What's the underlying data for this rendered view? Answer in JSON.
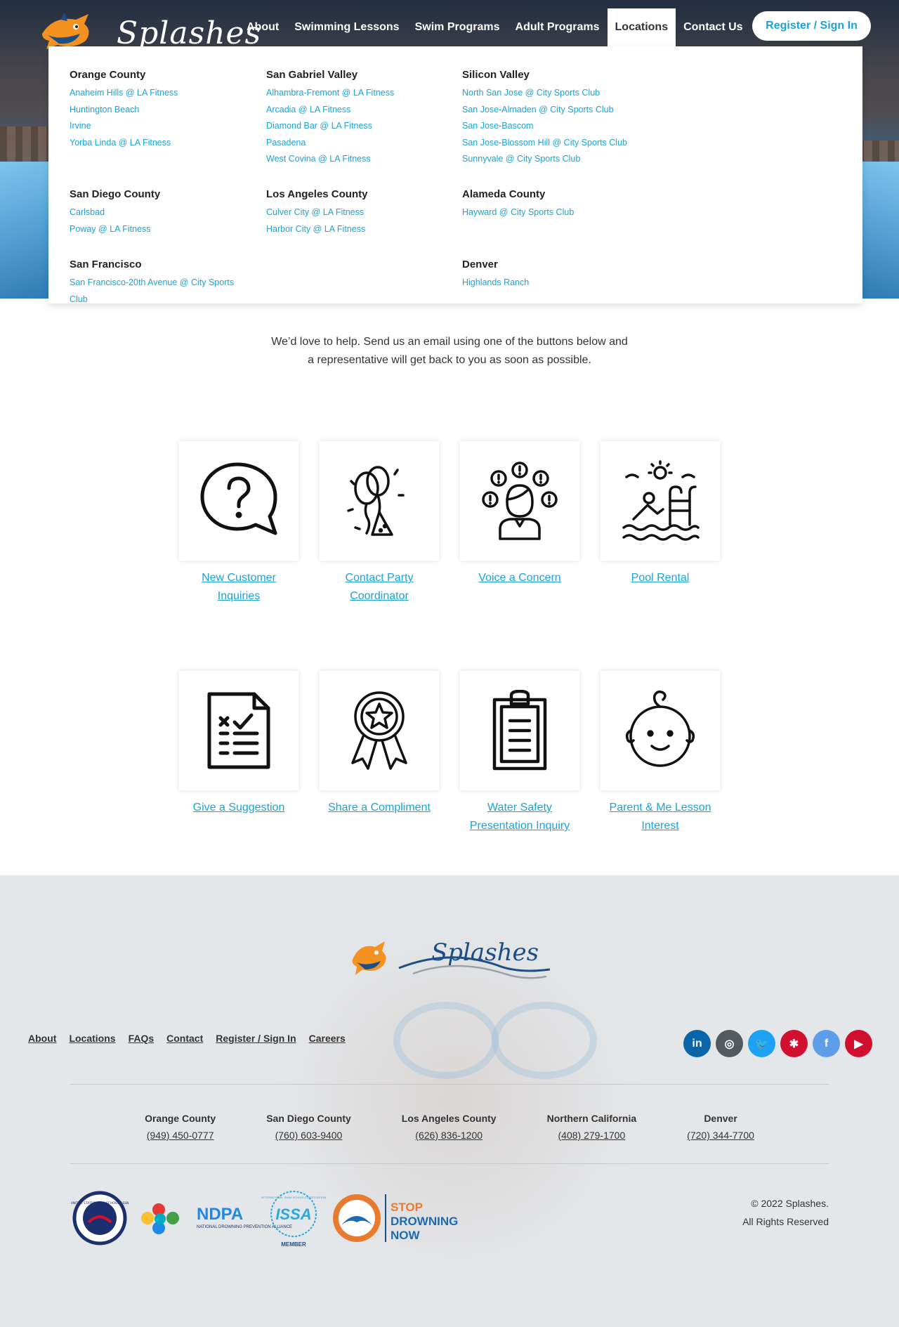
{
  "brand": {
    "logo_text": "Splashes"
  },
  "nav": {
    "items": [
      "About",
      "Swimming Lessons",
      "Swim Programs",
      "Adult Programs",
      "Locations",
      "Contact Us"
    ],
    "active": "Locations",
    "register_label": "Register / Sign In"
  },
  "locations": {
    "orange": {
      "title": "Orange County",
      "links": [
        "Anaheim Hills @ LA Fitness",
        "Huntington Beach",
        "Irvine",
        "Yorba Linda @ LA Fitness"
      ]
    },
    "sgv": {
      "title": "San Gabriel Valley",
      "links": [
        "Alhambra-Fremont @ LA Fitness",
        "Arcadia @ LA Fitness",
        "Diamond Bar @ LA Fitness",
        "Pasadena",
        "West Covina @ LA Fitness"
      ]
    },
    "silicon": {
      "title": "Silicon Valley",
      "links": [
        "North San Jose @ City Sports Club",
        "San Jose-Almaden @ City Sports Club",
        "San Jose-Bascom",
        "San Jose-Blossom Hill @ City Sports Club",
        "Sunnyvale @ City Sports Club"
      ]
    },
    "sandiego": {
      "title": "San Diego County",
      "links": [
        "Carlsbad",
        "Poway @ LA Fitness"
      ]
    },
    "la": {
      "title": "Los Angeles County",
      "links": [
        "Culver City @ LA Fitness",
        "Harbor City @ LA Fitness"
      ]
    },
    "alameda": {
      "title": "Alameda County",
      "links": [
        "Hayward @ City Sports Club"
      ]
    },
    "sf": {
      "title": "San Francisco",
      "links": [
        "San Francisco-20th Avenue @ City Sports Club"
      ]
    },
    "denver": {
      "title": "Denver",
      "links": [
        "Highlands Ranch"
      ]
    }
  },
  "intro": {
    "line1": "We’d love to help. Send us an email using one of the buttons below and",
    "line2": "a representative will get back to you as soon as possible."
  },
  "cards": [
    {
      "label": "New Customer Inquiries",
      "icon": "question-bubble-icon"
    },
    {
      "label": "Contact Party Coordinator",
      "icon": "party-balloons-icon"
    },
    {
      "label": "Voice a Concern",
      "icon": "concern-person-icon"
    },
    {
      "label": "Pool Rental",
      "icon": "pool-swimmer-icon"
    },
    {
      "label": "Give a Suggestion",
      "icon": "checklist-document-icon"
    },
    {
      "label": "Share a Compliment",
      "icon": "award-ribbon-icon"
    },
    {
      "label": "Water Safety Presentation Inquiry",
      "icon": "clipboard-icon"
    },
    {
      "label": "Parent & Me Lesson Interest",
      "icon": "baby-face-icon"
    }
  ],
  "footer": {
    "logo_text": "Splashes",
    "links": [
      "About",
      "Locations",
      "FAQs",
      "Contact",
      "Register / Sign In",
      "Careers"
    ],
    "social": [
      {
        "icon": "linkedin-icon",
        "glyph": "in",
        "color": "#0a66a8"
      },
      {
        "icon": "instagram-icon",
        "glyph": "◎",
        "color": "#555a60"
      },
      {
        "icon": "twitter-icon",
        "glyph": "🐦",
        "color": "#1da1f2"
      },
      {
        "icon": "yelp-icon",
        "glyph": "✱",
        "color": "#d0102e"
      },
      {
        "icon": "facebook-icon",
        "glyph": "f",
        "color": "#5e9ee8"
      },
      {
        "icon": "youtube-icon",
        "glyph": "▶",
        "color": "#d0102e"
      }
    ],
    "phones": [
      {
        "region": "Orange County",
        "number": "(949) 450-0777"
      },
      {
        "region": "San Diego County",
        "number": "(760) 603-9400"
      },
      {
        "region": "Los Angeles County",
        "number": "(626) 836-1200"
      },
      {
        "region": "Northern California",
        "number": "(408) 279-1700"
      },
      {
        "region": "Denver",
        "number": "(720) 344-7700"
      }
    ],
    "badges": {
      "ussa": "UNITED STATES SWIM SCHOOL ASSN",
      "ndpa": "NDPA",
      "ndpa_sub": "NATIONAL DROWNING PREVENTION ALLIANCE",
      "issa": "ISSA",
      "issa_ring": "INTERNATIONAL SWIM SCHOOLS ASSOCIATION",
      "issa_member": "MEMBER",
      "sdn_1": "STOP",
      "sdn_2": "DROWNING",
      "sdn_3": "NOW"
    },
    "copyright_line1": "© 2022 Splashes.",
    "copyright_line2": "All Rights Reserved"
  }
}
